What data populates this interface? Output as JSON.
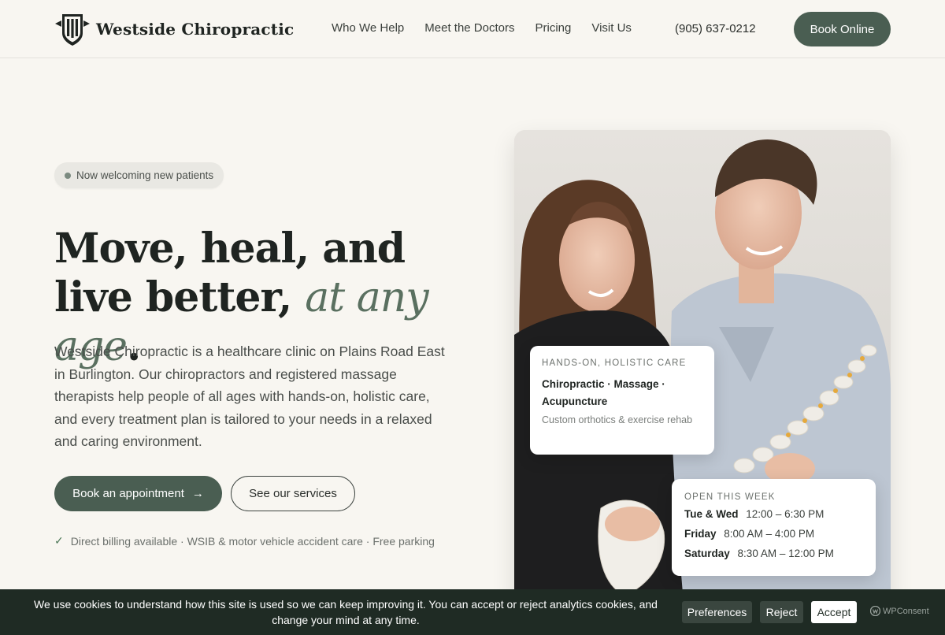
{
  "brand": {
    "name": "Westside Chiropractic"
  },
  "nav": {
    "items": [
      "Who We Help",
      "Meet the Doctors",
      "Pricing",
      "Visit Us"
    ],
    "phone": "(905) 637-0212",
    "cta": "Book Online"
  },
  "hero": {
    "badge": "Now welcoming new patients",
    "headline_main": "Move, heal, and live better, ",
    "headline_accent": "at any age",
    "headline_end": ".",
    "intro": "Westside Chiropractic is a healthcare clinic on Plains Road East in Burlington. Our chiropractors and registered massage therapists help people of all ages with hands-on, holistic care, and every treatment plan is tailored to your needs in a relaxed and caring environment.",
    "primary_cta": "Book an appointment",
    "secondary_cta": "See our services",
    "features": "Direct billing available · WSIB & motor vehicle accident care · Free parking"
  },
  "care_card": {
    "eyebrow": "Hands-on, holistic care",
    "title": "Chiropractic · Massage · Acupuncture",
    "subtitle": "Custom orthotics & exercise rehab"
  },
  "hours_card": {
    "eyebrow": "Open this week",
    "rows": [
      {
        "day": "Tue & Wed",
        "time": "12:00 – 6:30 PM"
      },
      {
        "day": "Friday",
        "time": "8:00 AM – 4:00 PM"
      },
      {
        "day": "Saturday",
        "time": "8:30 AM – 12:00 PM"
      }
    ]
  },
  "cookie": {
    "text": "We use cookies to understand how this site is used so we can keep improving it. You can accept or reject analytics cookies, and change your mind at any time.",
    "preferences": "Preferences",
    "reject": "Reject",
    "accept": "Accept",
    "provider": "WPConsent"
  },
  "colors": {
    "brand": "#4a5e52",
    "accent_text": "#5a7060",
    "cookie_bg": "#1f2b24"
  },
  "icons": {
    "logo": "crest-shield-icon",
    "arrow": "arrow-right-icon",
    "check": "check-icon"
  }
}
